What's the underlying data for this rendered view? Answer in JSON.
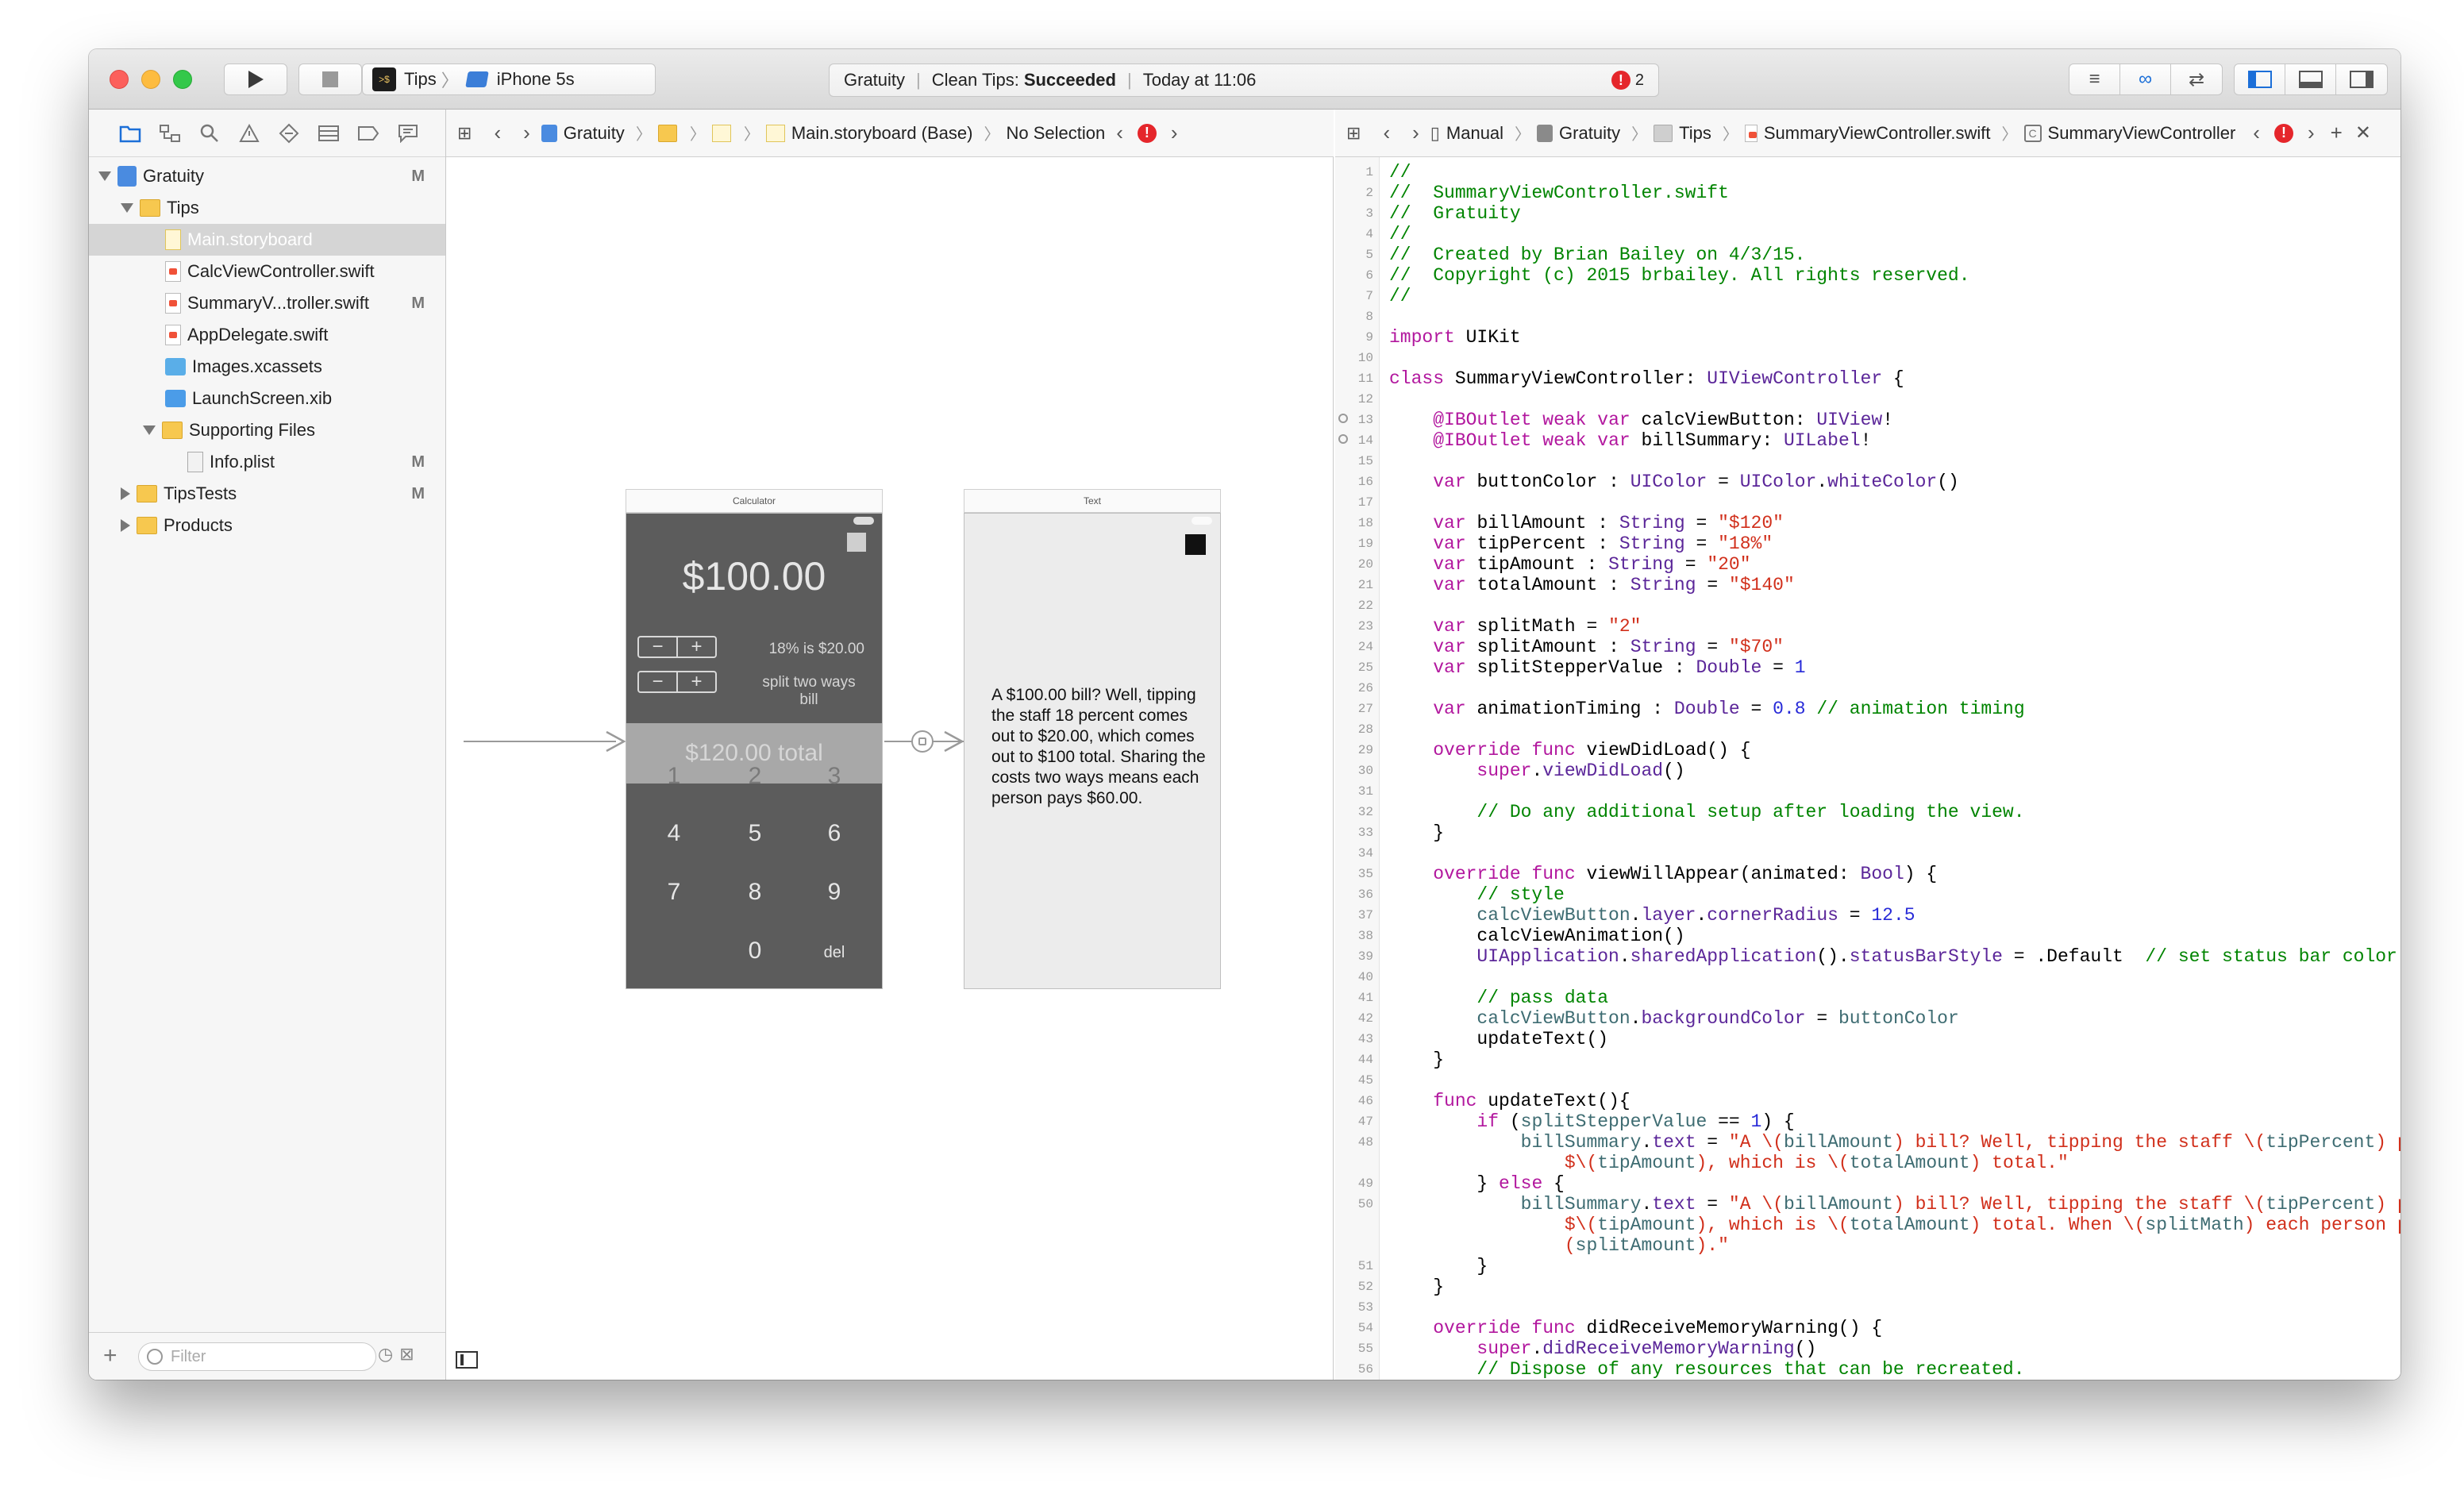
{
  "toolbar": {
    "scheme": "Tips",
    "device": "iPhone 5s",
    "status_project": "Gratuity",
    "status_action": "Clean Tips:",
    "status_result": "Succeeded",
    "status_time": "Today at 11:06",
    "error_count": "2"
  },
  "navigator": {
    "items": [
      {
        "label": "Gratuity",
        "mark": "M"
      },
      {
        "label": "Tips",
        "mark": ""
      },
      {
        "label": "Main.storyboard",
        "mark": ""
      },
      {
        "label": "CalcViewController.swift",
        "mark": ""
      },
      {
        "label": "SummaryV...troller.swift",
        "mark": "M"
      },
      {
        "label": "AppDelegate.swift",
        "mark": ""
      },
      {
        "label": "Images.xcassets",
        "mark": ""
      },
      {
        "label": "LaunchScreen.xib",
        "mark": ""
      },
      {
        "label": "Supporting Files",
        "mark": ""
      },
      {
        "label": "Info.plist",
        "mark": "M"
      },
      {
        "label": "TipsTests",
        "mark": "M"
      },
      {
        "label": "Products",
        "mark": ""
      }
    ],
    "filter_placeholder": "Filter"
  },
  "jump_left": {
    "items": [
      "Gratuity",
      "Main.storyboard (Base)",
      "No Selection"
    ]
  },
  "jump_right": {
    "items": [
      "Manual",
      "Gratuity",
      "Tips",
      "SummaryViewController.swift",
      "SummaryViewController"
    ]
  },
  "storyboard": {
    "calc_title": "Calculator",
    "calc_amount": "$100.00",
    "calc_tip_label": "18% is $20.00",
    "calc_split_label": "split two ways bill",
    "calc_total": "$120.00 total",
    "keys": [
      "1",
      "2",
      "3",
      "4",
      "5",
      "6",
      "7",
      "8",
      "9",
      "0",
      "del"
    ],
    "text_title": "Text",
    "text_body": "A $100.00 bill? Well, tipping the staff 18 percent comes out to $20.00, which comes out to $100 total. Sharing the costs two ways means each person pays $60.00."
  },
  "code": {
    "line_numbers": [
      "1",
      "2",
      "3",
      "4",
      "5",
      "6",
      "7",
      "8",
      "9",
      "10",
      "11",
      "12",
      "13",
      "14",
      "15",
      "16",
      "17",
      "18",
      "19",
      "20",
      "21",
      "22",
      "23",
      "24",
      "25",
      "26",
      "27",
      "28",
      "29",
      "30",
      "31",
      "32",
      "33",
      "34",
      "35",
      "36",
      "37",
      "38",
      "39",
      "40",
      "41",
      "42",
      "43",
      "44",
      "45",
      "46",
      "47",
      "48",
      "",
      "49",
      "50",
      "",
      "",
      "51",
      "52",
      "53",
      "54",
      "55",
      "56"
    ]
  }
}
